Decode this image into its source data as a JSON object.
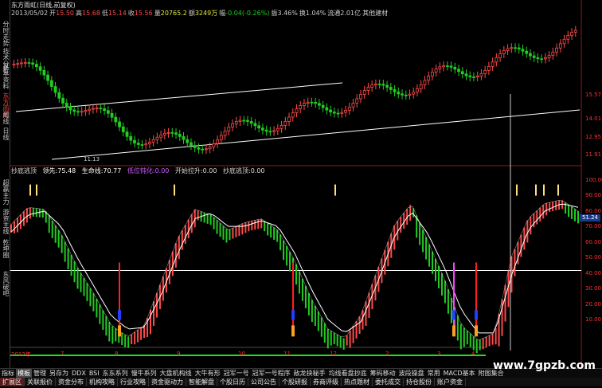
{
  "window": {
    "title": "东方雨虹(日线,前复权)"
  },
  "quote": {
    "date": "2013/05/02",
    "open_label": "开",
    "open": "15.50",
    "high_label": "高",
    "high": "15.68",
    "low_label": "低",
    "low": "15.14",
    "close_label": "收",
    "close": "15.56",
    "volume_label": "量",
    "volume": "20765.2",
    "amount_label": "额",
    "amount": "3249万",
    "change_label": "幅",
    "change": "-0.04(-0.26%)",
    "amplitude_label": "振",
    "amplitude": "3.46%",
    "turnover_label": "换",
    "turnover": "1.04%",
    "float_label": "流通",
    "float": "2.01亿",
    "extra": "其他建材"
  },
  "sidebar": {
    "tabs": [
      "分时走势",
      "技术分析",
      "基本资料",
      "东方雨虹",
      "周线",
      "日线",
      "超赢主力",
      "游资主线",
      "乾坤圈",
      "东风破吧"
    ]
  },
  "price_axis": [
    "15.57",
    "14.01",
    "12.95",
    "11.91"
  ],
  "price_low_marker": "11.13",
  "indicator": {
    "name": "抄底逃顶",
    "fields": [
      {
        "label": "领先:",
        "value": "75.48"
      },
      {
        "label": "生命线:",
        "value": "70.77"
      },
      {
        "label": "低位钝化:",
        "value": "0.00"
      },
      {
        "label": "开始拉升:",
        "value": "0.00"
      },
      {
        "label": "抄底逃顶:",
        "value": "0.00"
      }
    ]
  },
  "ind_axis": [
    "100.00",
    "90.00",
    "80.00",
    "70.00",
    "60.00",
    "50.00",
    "40.00",
    "30.00",
    "20.00",
    "10.00"
  ],
  "highlight_value": "51.24",
  "dates": [
    "2012年",
    "7",
    "8",
    "9",
    "10",
    "11",
    "12",
    "2",
    "3",
    "4"
  ],
  "tabs_row1": [
    "指标",
    "模板",
    "管理",
    "另存为",
    "DDX",
    "BSI",
    "东东系列",
    "慢牛系列",
    "大盘机构线",
    "大牛有形",
    "冠军一号",
    "冠军一号程序",
    "敌龙抉秘手",
    "均线看盘抄底",
    "筹码移动",
    "波段操盘",
    "常用",
    "MACD基本",
    "附图集合"
  ],
  "tabs_row1_active": "模板",
  "tabs_row2": [
    "扩展区",
    "关联报价",
    "资金分布",
    "机构攻略",
    "行业攻略",
    "资金驱动力",
    "智能解盘",
    "个股日历",
    "公司公告",
    "个股研报",
    "券商评级",
    "热点题材",
    "委托成交",
    "持仓股份",
    "账户资金"
  ],
  "tabs_row2_active": "扩展区",
  "watermark": "www.7gpzb.com",
  "colors": {
    "up": "#ff4a4a",
    "down": "#22cc22",
    "accent": "#ff3030",
    "ma": "#ffffff",
    "highlight": "#1a3a8a"
  },
  "chart_data": {
    "type": "line",
    "title": "东方雨虹(日线,前复权)",
    "series": [
      {
        "name": "领先",
        "values": [
          75,
          84,
          83,
          70,
          52,
          38,
          22,
          16,
          22,
          45,
          68,
          83,
          80,
          72,
          76,
          78,
          72,
          56,
          36,
          20,
          15,
          28,
          52,
          75,
          86,
          66,
          46,
          22,
          14,
          18,
          58,
          78,
          86,
          88,
          82
        ]
      },
      {
        "name": "生命线",
        "values": [
          71,
          80,
          82,
          74,
          57,
          42,
          27,
          20,
          21,
          38,
          60,
          78,
          81,
          74,
          74,
          77,
          74,
          60,
          41,
          25,
          18,
          24,
          45,
          69,
          82,
          70,
          52,
          30,
          18,
          18,
          48,
          72,
          82,
          86,
          84
        ]
      }
    ],
    "ylim": [
      10,
      100
    ]
  }
}
